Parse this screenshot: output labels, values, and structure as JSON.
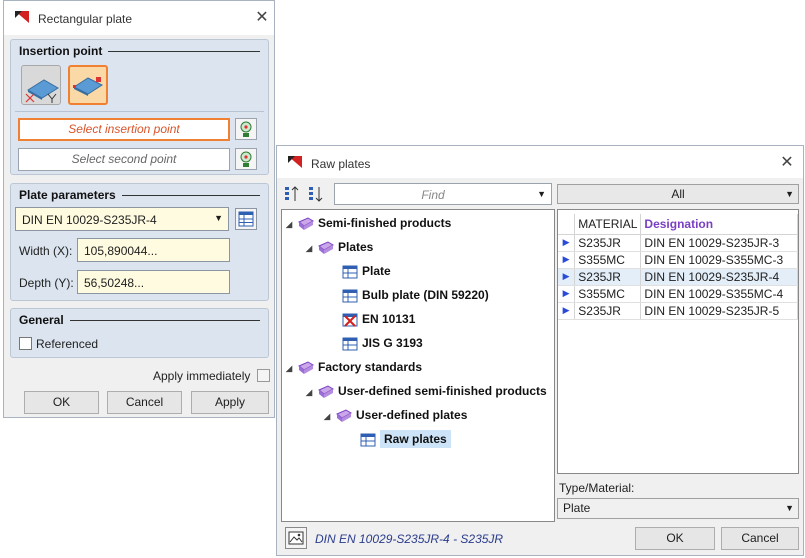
{
  "rect_plate": {
    "title": "Rectangular plate",
    "close_glyph": "✕",
    "insertion": {
      "title": "Insertion point",
      "select_insertion": "Select insertion point",
      "select_second": "Select second point"
    },
    "params": {
      "title": "Plate parameters",
      "material": "DIN EN 10029-S235JR-4",
      "width_label": "Width (X):",
      "width_value": "105,890044...",
      "depth_label": "Depth (Y):",
      "depth_value": "56,50248..."
    },
    "general": {
      "title": "General",
      "referenced_label": "Referenced",
      "referenced_checked": false
    },
    "apply_immediately_label": "Apply immediately",
    "ok_label": "OK",
    "cancel_label": "Cancel",
    "apply_label": "Apply"
  },
  "raw_plates": {
    "title": "Raw plates",
    "close_glyph": "✕",
    "find_placeholder": "Find",
    "filter_value": "All",
    "tree": [
      {
        "label": "Semi-finished products",
        "bold": true
      },
      {
        "label": "Plates",
        "bold": true
      },
      {
        "label": "Plate",
        "bold": true
      },
      {
        "label": "Bulb plate (DIN 59220)",
        "bold": true
      },
      {
        "label": "EN 10131",
        "bold": true
      },
      {
        "label": "JIS G 3193",
        "bold": true
      },
      {
        "label": "Factory standards",
        "bold": true
      },
      {
        "label": "User-defined semi-finished products",
        "bold": true
      },
      {
        "label": "User-defined plates",
        "bold": true
      },
      {
        "label": "Raw plates",
        "bold": true,
        "selected": true
      }
    ],
    "table": {
      "col_material": "MATERIAL",
      "col_designation": "Designation",
      "rows": [
        {
          "material": "S235JR",
          "designation": "DIN EN 10029-S235JR-3"
        },
        {
          "material": "S355MC",
          "designation": "DIN EN 10029-S355MC-3"
        },
        {
          "material": "S235JR",
          "designation": "DIN EN 10029-S235JR-4"
        },
        {
          "material": "S355MC",
          "designation": "DIN EN 10029-S355MC-4"
        },
        {
          "material": "S235JR",
          "designation": "DIN EN 10029-S235JR-5"
        }
      ]
    },
    "type_material_label": "Type/Material:",
    "type_material_value": "Plate",
    "status_text": "DIN EN 10029-S235JR-4 - S235JR",
    "ok_label": "OK",
    "cancel_label": "Cancel"
  },
  "colors": {
    "accent_orange": "#f08032",
    "designation_header": "#7a3fc4",
    "row_selected": "#e3eef9",
    "row_marker": "#2a4bd7"
  }
}
